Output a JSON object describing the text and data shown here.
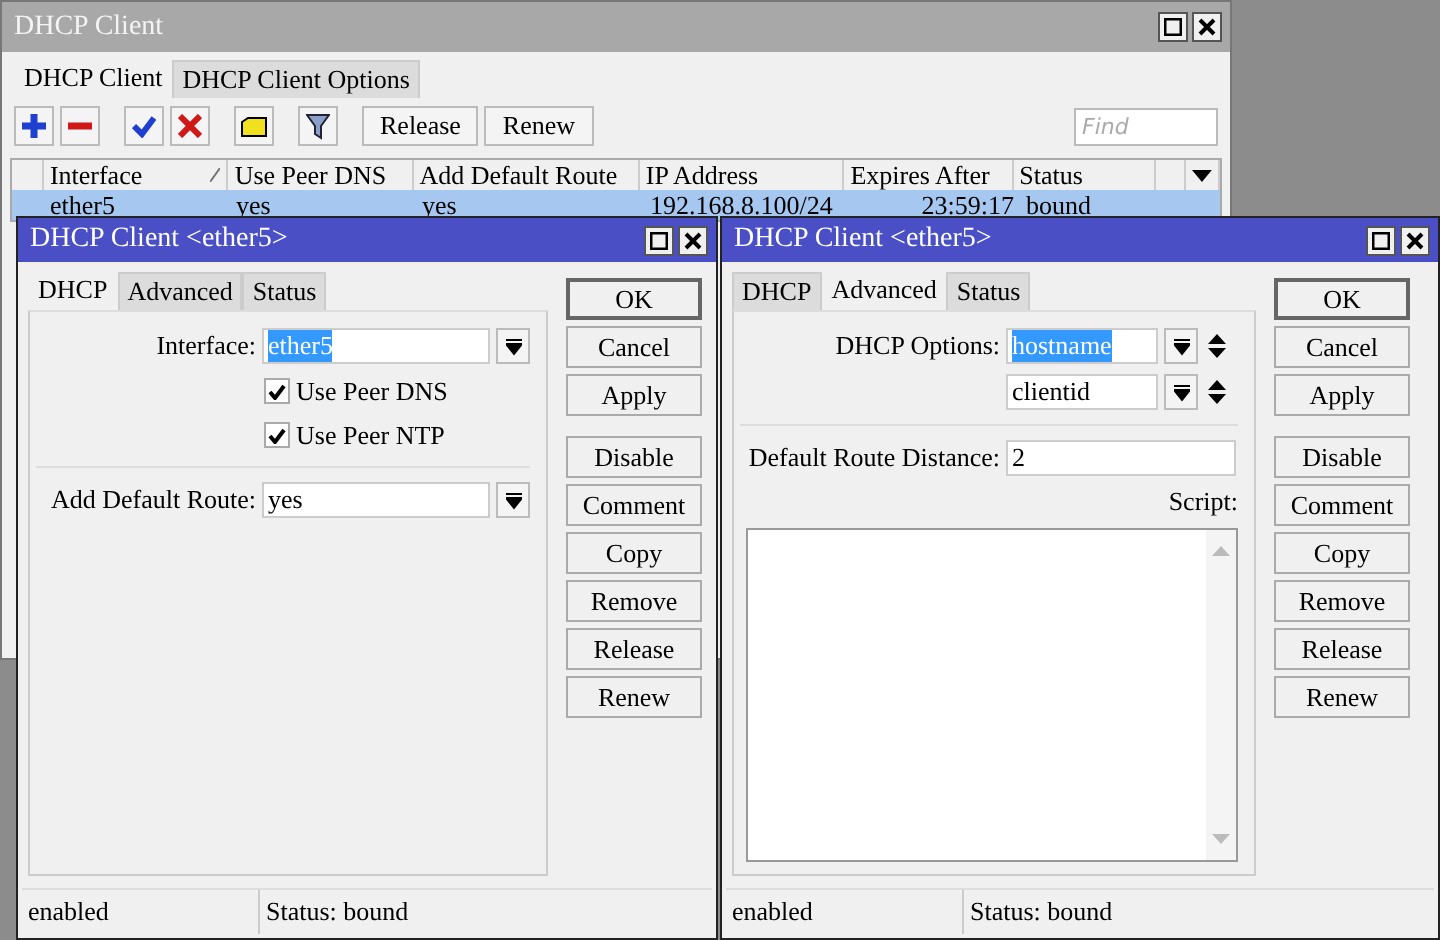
{
  "main_window": {
    "title": "DHCP Client",
    "tabs": [
      {
        "label": "DHCP Client",
        "selected": true
      },
      {
        "label": "DHCP Client Options",
        "selected": false
      }
    ],
    "toolbar_buttons": [
      "Release",
      "Renew"
    ],
    "find": {
      "placeholder": "Find"
    },
    "table": {
      "columns": [
        {
          "label": "Interface",
          "sorted": true
        },
        {
          "label": "Use Peer DNS",
          "sorted": false
        },
        {
          "label": "Add Default Route",
          "sorted": false
        },
        {
          "label": "IP Address",
          "sorted": false
        },
        {
          "label": "Expires After",
          "sorted": false
        },
        {
          "label": "Status",
          "sorted": false
        }
      ],
      "rows": [
        {
          "selected": true,
          "cells": [
            "ether5",
            "yes",
            "yes",
            "192.168.8.100/24",
            "23:59:17",
            "bound"
          ]
        }
      ]
    }
  },
  "dialogs": [
    {
      "kind": "dhcp",
      "title": "DHCP Client <ether5>",
      "tabs": [
        {
          "label": "DHCP",
          "selected": true
        },
        {
          "label": "Advanced",
          "selected": false
        },
        {
          "label": "Status",
          "selected": false
        }
      ],
      "interface": {
        "label": "Interface:",
        "value": "ether5",
        "highlighted": true
      },
      "checkboxes": [
        {
          "label": "Use Peer DNS",
          "checked": true
        },
        {
          "label": "Use Peer NTP",
          "checked": true
        }
      ],
      "add_default_route": {
        "label": "Add Default Route:",
        "value": "yes"
      },
      "button_groups": [
        [
          "OK",
          "Cancel",
          "Apply"
        ],
        [
          "Disable",
          "Comment",
          "Copy",
          "Remove",
          "Release",
          "Renew"
        ]
      ],
      "status_bar": [
        "enabled",
        "Status: bound"
      ]
    },
    {
      "kind": "advanced",
      "title": "DHCP Client <ether5>",
      "tabs": [
        {
          "label": "DHCP",
          "selected": false
        },
        {
          "label": "Advanced",
          "selected": true
        },
        {
          "label": "Status",
          "selected": false
        }
      ],
      "dhcp_options": {
        "label": "DHCP Options:",
        "values": [
          {
            "value": "hostname",
            "highlighted": true
          },
          {
            "value": "clientid",
            "highlighted": false
          }
        ]
      },
      "default_route_distance": {
        "label": "Default Route Distance:",
        "value": "2"
      },
      "script": {
        "label": "Script:"
      },
      "button_groups": [
        [
          "OK",
          "Cancel",
          "Apply"
        ],
        [
          "Disable",
          "Comment",
          "Copy",
          "Remove",
          "Release",
          "Renew"
        ]
      ],
      "status_bar": [
        "enabled",
        "Status: bound"
      ]
    }
  ]
}
